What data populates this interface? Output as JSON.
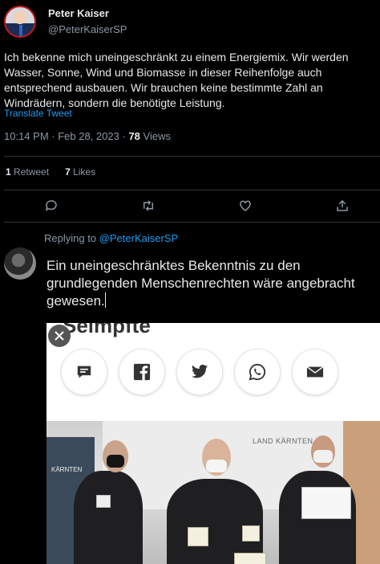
{
  "author": {
    "display_name": "Peter Kaiser",
    "handle": "@PeterKaiserSP"
  },
  "tweet": {
    "text": "Ich bekenne mich uneingeschränkt zu einem Energiemix. Wir werden Wasser, Sonne, Wind und Biomasse in dieser Reihenfolge auch entsprechend ausbauen. Wir brauchen keine bestimmte Zahl an Windrädern, sondern die benötigte Leistung.",
    "translate_label": "Translate Tweet",
    "time": "10:14 PM",
    "date": "Feb 28, 2023",
    "views_count": "78",
    "views_label": "Views"
  },
  "stats": {
    "retweets_count": "1",
    "retweets_label": "Retweet",
    "likes_count": "7",
    "likes_label": "Likes"
  },
  "actions": {
    "icons": [
      "reply-icon",
      "retweet-icon",
      "like-icon",
      "share-icon"
    ]
  },
  "reply": {
    "replying_prefix": "Replying to",
    "replying_handle": "@PeterKaiserSP",
    "text": "Ein uneingeschränktes Bekenntnis zu den grundlegenden Menschenrechten wäre angebracht gewesen."
  },
  "embed": {
    "partial_heading": "Seimpfte",
    "share_icons": [
      "message-icon",
      "facebook-icon",
      "twitter-icon",
      "whatsapp-icon",
      "email-icon"
    ],
    "photo_brand": "LAND KÄRNTEN",
    "photo_brand_left": "KÄRNTEN"
  },
  "colors": {
    "background": "#000000",
    "link": "#1d9bf0",
    "secondary_text": "#8b98a5",
    "divider": "#2f3336"
  }
}
